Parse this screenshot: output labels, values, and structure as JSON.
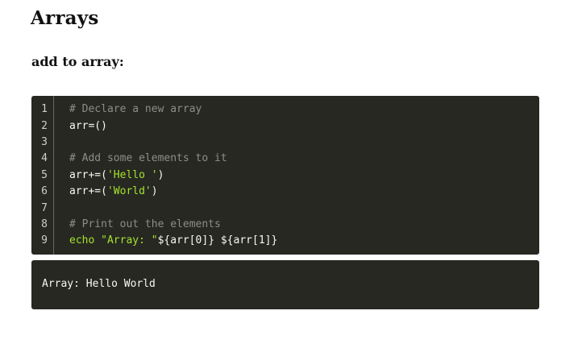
{
  "page": {
    "title": "Arrays",
    "section_heading": "add to array:"
  },
  "code": {
    "language": "bash",
    "line_numbers": [
      "1",
      "2",
      "3",
      "4",
      "5",
      "6",
      "7",
      "8",
      "9"
    ],
    "lines": [
      [
        {
          "t": "comment",
          "v": "# Declare a new array"
        }
      ],
      [
        {
          "t": "plain",
          "v": "arr=()"
        }
      ],
      [],
      [
        {
          "t": "comment",
          "v": "# Add some elements to it"
        }
      ],
      [
        {
          "t": "plain",
          "v": "arr+=("
        },
        {
          "t": "string",
          "v": "'Hello '"
        },
        {
          "t": "plain",
          "v": ")"
        }
      ],
      [
        {
          "t": "plain",
          "v": "arr+=("
        },
        {
          "t": "string",
          "v": "'World'"
        },
        {
          "t": "plain",
          "v": ")"
        }
      ],
      [],
      [
        {
          "t": "comment",
          "v": "# Print out the elements"
        }
      ],
      [
        {
          "t": "keyword",
          "v": "echo "
        },
        {
          "t": "string",
          "v": "\"Array: \""
        },
        {
          "t": "plain",
          "v": "${arr[0]} ${arr[1]}"
        }
      ]
    ]
  },
  "output": {
    "text": "Array: Hello World"
  },
  "colors": {
    "code_background": "#272822",
    "comment": "#8b8e88",
    "plain": "#f8f8f2",
    "string": "#a6e22e",
    "keyword": "#a6e22e"
  }
}
